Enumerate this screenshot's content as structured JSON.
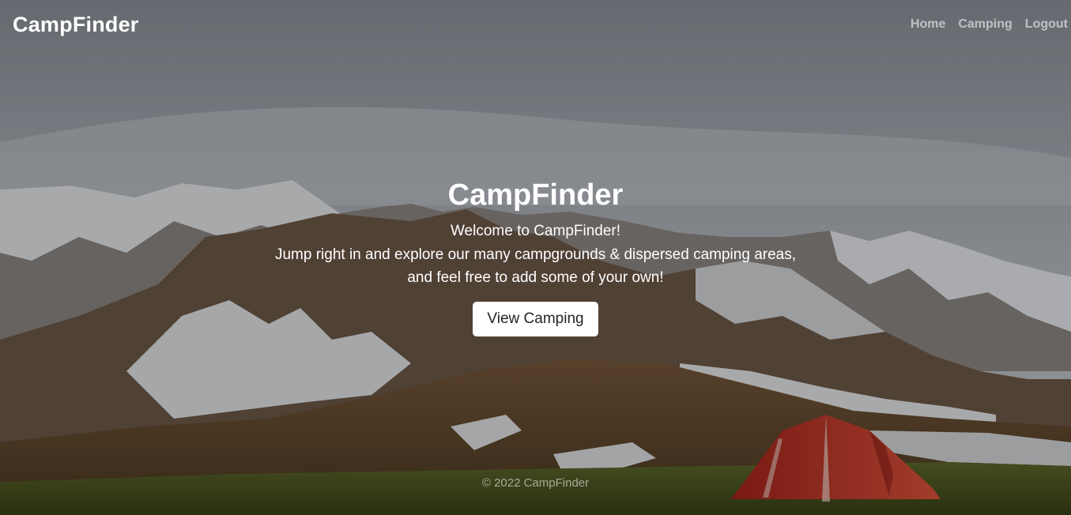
{
  "header": {
    "brand": "CampFinder",
    "nav": [
      {
        "label": "Home"
      },
      {
        "label": "Camping"
      },
      {
        "label": "Logout"
      }
    ]
  },
  "hero": {
    "title": "CampFinder",
    "lines": [
      "Welcome to CampFinder!",
      "Jump right in and explore our many campgrounds & dispersed camping areas,",
      "and feel free to add some of your own!"
    ],
    "button_label": "View Camping"
  },
  "footer": {
    "text": "© 2022 CampFinder"
  }
}
